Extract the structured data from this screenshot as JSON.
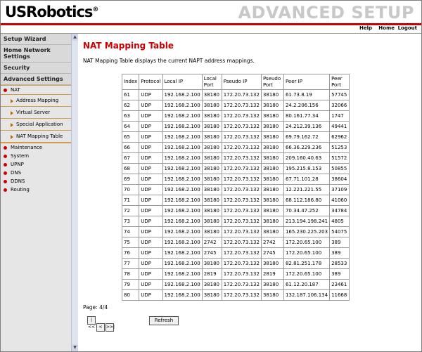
{
  "header": {
    "brand": "USRobotics",
    "banner": "ADVANCED SETUP",
    "nav": {
      "help": "Help",
      "home": "Home",
      "logout": "Logout"
    }
  },
  "sidebar": {
    "sections": [
      "Setup Wizard",
      "Home Network Settings",
      "Security",
      "Advanced Settings"
    ],
    "nat": {
      "label": "NAT",
      "children": [
        "Address Mapping",
        "Virtual Server",
        "Special Application",
        "NAT Mapping Table"
      ]
    },
    "items": [
      "Maintenance",
      "System",
      "UPNP",
      "DNS",
      "DDNS",
      "Routing"
    ]
  },
  "main": {
    "title": "NAT Mapping Table",
    "description": "NAT Mapping Table displays the current NAPT address mappings.",
    "columns": [
      "Index",
      "Protocol",
      "Local IP",
      "Local Port",
      "Pseudo IP",
      "Pseudo Port",
      "Peer IP",
      "Peer Port"
    ],
    "rows": [
      [
        "61",
        "UDP",
        "192.168.2.100",
        "38180",
        "172.20.73.132",
        "38180",
        "61.73.8.19",
        "57745"
      ],
      [
        "62",
        "UDP",
        "192.168.2.100",
        "38180",
        "172.20.73.132",
        "38180",
        "24.2.206.156",
        "32066"
      ],
      [
        "63",
        "UDP",
        "192.168.2.100",
        "38180",
        "172.20.73.132",
        "38180",
        "80.161.77.34",
        "1747"
      ],
      [
        "64",
        "UDP",
        "192.168.2.100",
        "38180",
        "172.20.73.132",
        "38180",
        "24.212.39.136",
        "49441"
      ],
      [
        "65",
        "UDP",
        "192.168.2.100",
        "38180",
        "172.20.73.132",
        "38180",
        "69.79.162.72",
        "62962"
      ],
      [
        "66",
        "UDP",
        "192.168.2.100",
        "38180",
        "172.20.73.132",
        "38180",
        "66.36.229.236",
        "51253"
      ],
      [
        "67",
        "UDP",
        "192.168.2.100",
        "38180",
        "172.20.73.132",
        "38180",
        "209.160.40.63",
        "51572"
      ],
      [
        "68",
        "UDP",
        "192.168.2.100",
        "38180",
        "172.20.73.132",
        "38180",
        "195.215.8.153",
        "50855"
      ],
      [
        "69",
        "UDP",
        "192.168.2.100",
        "38180",
        "172.20.73.132",
        "38180",
        "67.71.101.28",
        "38604"
      ],
      [
        "70",
        "UDP",
        "192.168.2.100",
        "38180",
        "172.20.73.132",
        "38180",
        "12.221.221.55",
        "37109"
      ],
      [
        "71",
        "UDP",
        "192.168.2.100",
        "38180",
        "172.20.73.132",
        "38180",
        "68.112.186.80",
        "41060"
      ],
      [
        "72",
        "UDP",
        "192.168.2.100",
        "38180",
        "172.20.73.132",
        "38180",
        "70.34.47.252",
        "34784"
      ],
      [
        "73",
        "UDP",
        "192.168.2.100",
        "38180",
        "172.20.73.132",
        "38180",
        "213.194.198.241",
        "4805"
      ],
      [
        "74",
        "UDP",
        "192.168.2.100",
        "38180",
        "172.20.73.132",
        "38180",
        "165.230.225.203",
        "54075"
      ],
      [
        "75",
        "UDP",
        "192.168.2.100",
        "2742",
        "172.20.73.132",
        "2742",
        "172.20.65.100",
        "389"
      ],
      [
        "76",
        "UDP",
        "192.168.2.100",
        "2745",
        "172.20.73.132",
        "2745",
        "172.20.65.100",
        "389"
      ],
      [
        "77",
        "UDP",
        "192.168.2.100",
        "38180",
        "172.20.73.132",
        "38180",
        "82.81.251.178",
        "28533"
      ],
      [
        "78",
        "UDP",
        "192.168.2.100",
        "2819",
        "172.20.73.132",
        "2819",
        "172.20.65.100",
        "389"
      ],
      [
        "79",
        "UDP",
        "192.168.2.100",
        "38180",
        "172.20.73.132",
        "38180",
        "61.12.20.187",
        "23461"
      ],
      [
        "80",
        "UDP",
        "192.168.2.100",
        "38180",
        "172.20.73.132",
        "38180",
        "132.187.106.134",
        "11668"
      ]
    ],
    "page_info": "Page: 4/4",
    "pager": {
      "first": "|<<",
      "prev": "<",
      "last": ">>|"
    },
    "refresh_label": "Refresh"
  },
  "colors": {
    "accent": "#cc0000",
    "nat_border": "#d59b4d"
  }
}
